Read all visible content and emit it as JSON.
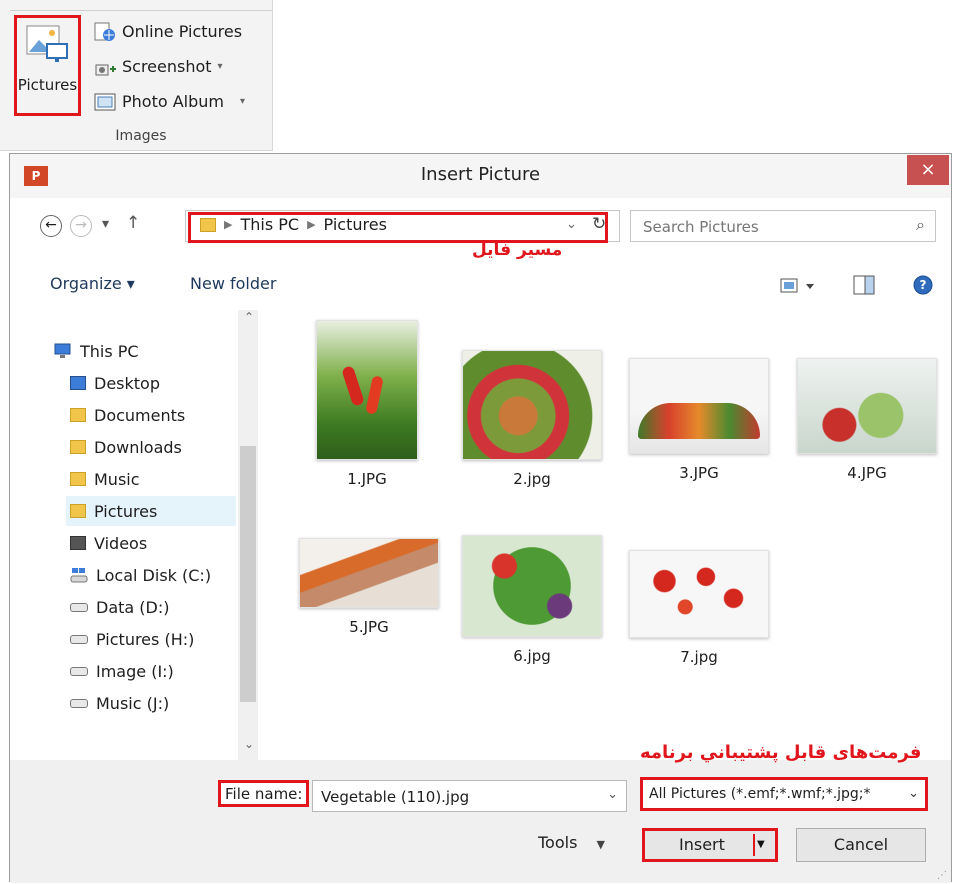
{
  "ribbon": {
    "pictures_label": "Pictures",
    "online_pictures_label": "Online Pictures",
    "screenshot_label": "Screenshot",
    "photo_album_label": "Photo Album",
    "group_label": "Images"
  },
  "dialog": {
    "title": "Insert Picture",
    "app_icon": "P",
    "close_label": "×",
    "breadcrumb": [
      "This PC",
      "Pictures"
    ],
    "search_placeholder": "Search Pictures",
    "path_annotation": "مسير فايل",
    "organize_label": "Organize ▾",
    "new_folder_label": "New folder",
    "nav_items": [
      {
        "label": "This PC",
        "icon": "computer-icon"
      },
      {
        "label": "Desktop",
        "icon": "folder-icon"
      },
      {
        "label": "Documents",
        "icon": "folder-icon"
      },
      {
        "label": "Downloads",
        "icon": "folder-icon"
      },
      {
        "label": "Music",
        "icon": "folder-icon"
      },
      {
        "label": "Pictures",
        "icon": "folder-icon",
        "selected": true
      },
      {
        "label": "Videos",
        "icon": "folder-icon"
      },
      {
        "label": "Local Disk (C:)",
        "icon": "drive-icon"
      },
      {
        "label": "Data (D:)",
        "icon": "drive-icon"
      },
      {
        "label": "Pictures (H:)",
        "icon": "drive-icon"
      },
      {
        "label": "Image (I:)",
        "icon": "drive-icon"
      },
      {
        "label": "Music (J:)",
        "icon": "drive-icon"
      }
    ],
    "files": [
      "1.JPG",
      "2.jpg",
      "3.JPG",
      "4.JPG",
      "5.JPG",
      "6.jpg",
      "7.jpg"
    ],
    "file_name_label": "File name:",
    "file_name_value": "Vegetable (110).jpg",
    "formats_annotation": "فرمت‌های قابل پشتيباني برنامه",
    "filter_value": "All Pictures (*.emf;*.wmf;*.jpg;*",
    "tools_label": "Tools",
    "insert_label": "Insert",
    "cancel_label": "Cancel"
  }
}
